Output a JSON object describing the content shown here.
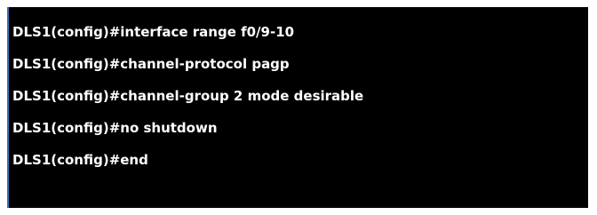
{
  "terminal": {
    "lines": [
      "DLS1(config)#interface range f0/9-10",
      "DLS1(config)#channel-protocol pagp",
      "DLS1(config)#channel-group 2 mode desirable",
      "DLS1(config)#no shutdown",
      "DLS1(config)#end"
    ]
  },
  "colors": {
    "background": "#000000",
    "text": "#ffffff",
    "left_edge": "#3b6fb6",
    "frame": "#ffffff"
  }
}
